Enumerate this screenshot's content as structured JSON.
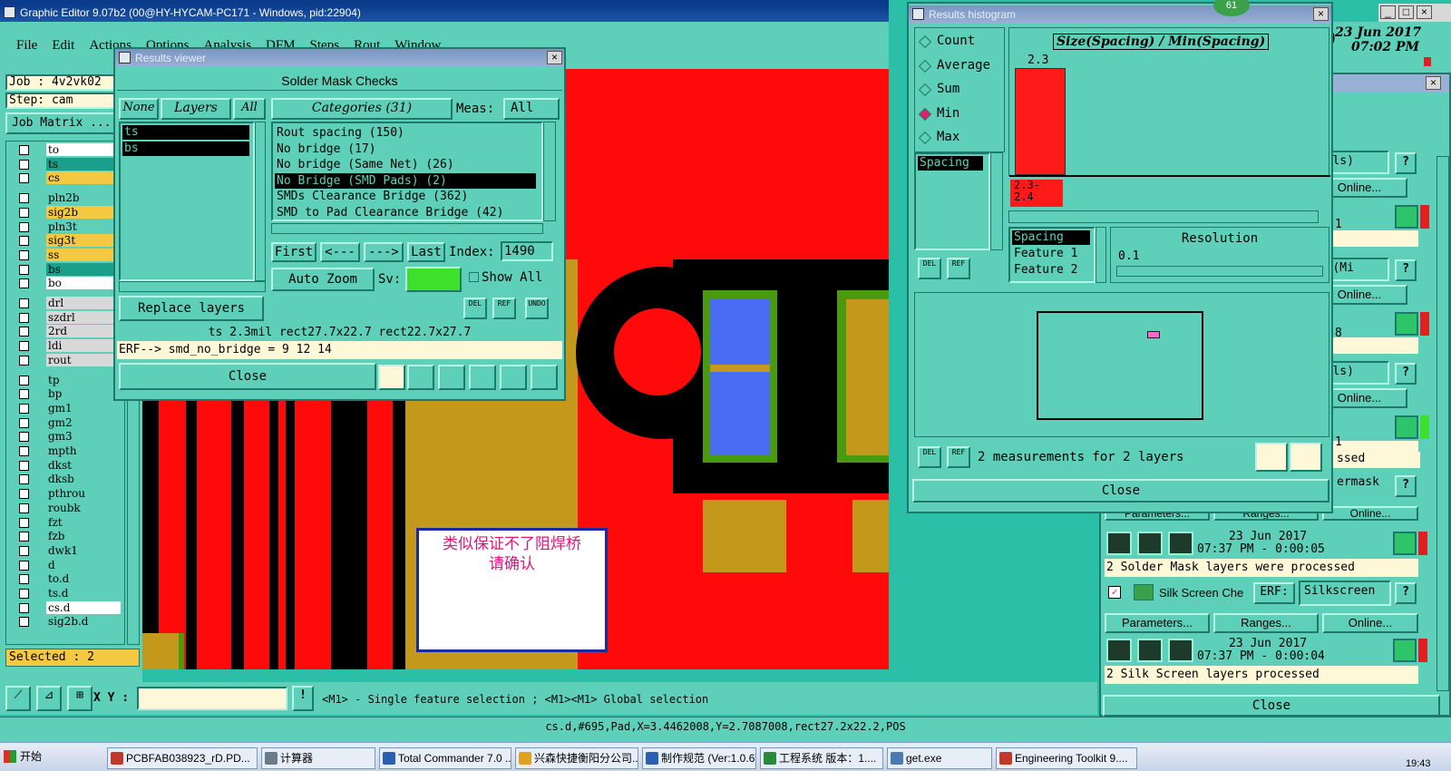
{
  "main_window": {
    "title": "Graphic Editor 9.07b2 (00@HY-HYCAM-PC171 - Windows, pid:22904)",
    "menu": [
      "File",
      "Edit",
      "Actions",
      "Options",
      "Analysis",
      "DFM",
      "Steps",
      "Rout",
      "Window"
    ],
    "job_label": "Job : 4v2vk02",
    "step_label": "Step: cam",
    "job_matrix_label": "Job Matrix ...",
    "clock_date": "23 Jun 2017",
    "clock_time": "07:02 PM",
    "clock_partial": "00"
  },
  "layers": [
    {
      "name": "to",
      "color": "#ffffff"
    },
    {
      "name": "ts",
      "color": "#1aa08a"
    },
    {
      "name": "cs",
      "color": "#f5c842"
    },
    {
      "name": "pln2b",
      "color": "#5ed0b9"
    },
    {
      "name": "sig2b",
      "color": "#f5c842"
    },
    {
      "name": "pln3t",
      "color": "#5ed0b9"
    },
    {
      "name": "sig3t",
      "color": "#f5c842"
    },
    {
      "name": "ss",
      "color": "#f5c842"
    },
    {
      "name": "bs",
      "color": "#1aa08a"
    },
    {
      "name": "bo",
      "color": "#ffffff"
    },
    {
      "name": "drl",
      "color": "#d8d8d8"
    },
    {
      "name": "szdrl",
      "color": "#d8d8d8"
    },
    {
      "name": "2rd",
      "color": "#d8d8d8"
    },
    {
      "name": "ldi",
      "color": "#d8d8d8"
    },
    {
      "name": "rout",
      "color": "#d8d8d8"
    },
    {
      "name": "tp",
      "color": "#5ed0b9"
    },
    {
      "name": "bp",
      "color": "#5ed0b9"
    },
    {
      "name": "gm1",
      "color": "#5ed0b9"
    },
    {
      "name": "gm2",
      "color": "#5ed0b9"
    },
    {
      "name": "gm3",
      "color": "#5ed0b9"
    },
    {
      "name": "mpth",
      "color": "#5ed0b9"
    },
    {
      "name": "dkst",
      "color": "#5ed0b9"
    },
    {
      "name": "dksb",
      "color": "#5ed0b9"
    },
    {
      "name": "pthrou",
      "color": "#5ed0b9"
    },
    {
      "name": "roubk",
      "color": "#5ed0b9"
    },
    {
      "name": "fzt",
      "color": "#5ed0b9"
    },
    {
      "name": "fzb",
      "color": "#5ed0b9"
    },
    {
      "name": "dwk1",
      "color": "#5ed0b9"
    },
    {
      "name": "d",
      "color": "#5ed0b9"
    },
    {
      "name": "to.d",
      "color": "#5ed0b9"
    },
    {
      "name": "ts.d",
      "color": "#5ed0b9"
    },
    {
      "name": "cs.d",
      "color": "#ffffff"
    },
    {
      "name": "sig2b.d",
      "color": "#5ed0b9"
    }
  ],
  "selected_label": "Selected : 2",
  "bottom_bar": {
    "xy_label": "X Y :",
    "hint": "<M1> - Single feature selection ; <M1><M1> Global selection",
    "status": "cs.d,#695,Pad,X=3.4462008,Y=2.7087008,rect27.2x22.2,POS"
  },
  "annotation": {
    "line1": "类似保证不了阻焊桥",
    "line2": "请确认"
  },
  "results_viewer": {
    "title": "Results viewer",
    "header": "Solder Mask Checks",
    "none_btn": "None",
    "layers_btn": "Layers",
    "all_btn": "All",
    "categories_btn": "Categories (31)",
    "meas_label": "Meas:",
    "meas_value": "All",
    "layer_items": [
      "ts",
      "bs"
    ],
    "categories": [
      "Rout spacing (150)",
      "No bridge (17)",
      "No bridge (Same Net) (26)",
      "No Bridge (SMD Pads) (2)",
      "SMDs Clearance Bridge (362)",
      "SMD to Pad Clearance Bridge (42)"
    ],
    "first": "First",
    "prev": "<---",
    "next": "--->",
    "last": "Last",
    "index_label": "Index:",
    "index_value": "1490",
    "auto_zoom": "Auto Zoom",
    "sv_label": "Sv:",
    "show_all": "Show All",
    "replace_layers": "Replace layers",
    "del": "DEL",
    "ref": "REF",
    "undo": "UNDO",
    "measure_line": "ts 2.3mil  rect27.7x22.7  rect22.7x27.7",
    "erf_line": "ERF--> smd_no_bridge = 9 12 14",
    "close": "Close"
  },
  "histogram": {
    "title": "Results histogram",
    "badge": "61",
    "options": [
      "Count",
      "Average",
      "Sum",
      "Min",
      "Max"
    ],
    "selected_option": "Min",
    "chart_title": "Size(Spacing) / Min(Spacing)",
    "bar_value_label": "2.3",
    "bin_label": "2.3-\n2.4",
    "left_list_item": "Spacing",
    "list_items": [
      "Spacing",
      "Feature 1",
      "Feature 2"
    ],
    "resolution_label": "Resolution",
    "resolution_value": "0.1",
    "measurement_text": "2 measurements for 2 layers",
    "close": "Close",
    "del": "DEL",
    "ref": "REF"
  },
  "checklist": {
    "rows": [
      {
        "label": "(Mils)",
        "kind": "mils"
      },
      {
        "label": "Online...",
        "kind": "online"
      },
      {
        "label": "al (Mi",
        "kind": "mils"
      },
      {
        "label": "Online...",
        "kind": "online"
      },
      {
        "label": "(Mils)",
        "kind": "mils"
      },
      {
        "label": "Online...",
        "kind": "online"
      }
    ],
    "partial_1": "1",
    "partial_8": "8",
    "partial_ssed": "ssed",
    "partial_ermask": "ermask",
    "params": "Parameters...",
    "ranges": "Ranges...",
    "online": "Online...",
    "solder_date": "23 Jun 2017",
    "solder_time": "07:37 PM - 0:00:05",
    "solder_status": "2 Solder Mask layers were processed",
    "silk_name": "Silk Screen Che",
    "erf_label": "ERF:",
    "erf_value": "Silkscreen",
    "silk_date": "23 Jun 2017",
    "silk_time": "07:37 PM - 0:00:04",
    "silk_status": "2 Silk Screen layers processed",
    "close": "Close",
    "help": "?"
  },
  "taskbar": {
    "start": "开始",
    "items": [
      {
        "label": "PCBFAB038923_rD.PD...",
        "icon_color": "#c0392b"
      },
      {
        "label": "计算器",
        "icon_color": "#6b7b8c"
      },
      {
        "label": "Total Commander 7.0 ...",
        "icon_color": "#2d5fb0"
      },
      {
        "label": "兴森快捷衡阳分公司...",
        "icon_color": "#e0a020"
      },
      {
        "label": "制作规范 (Ver:1.0.6)",
        "icon_color": "#2d5fb0"
      },
      {
        "label": "工程系统  版本：1....",
        "icon_color": "#2a8a3a"
      },
      {
        "label": "get.exe",
        "icon_color": "#4a7ab0"
      },
      {
        "label": "Engineering Toolkit 9....",
        "icon_color": "#c0392b"
      }
    ],
    "clock": "19:43"
  },
  "colors": {
    "panel": "#5ed0b9",
    "board_red": "#ff0a0a",
    "copper": "#c4981a",
    "pad_blue": "#4a6cf2",
    "mask_green": "#4a9a10",
    "title_blue": "#1d55a6"
  }
}
